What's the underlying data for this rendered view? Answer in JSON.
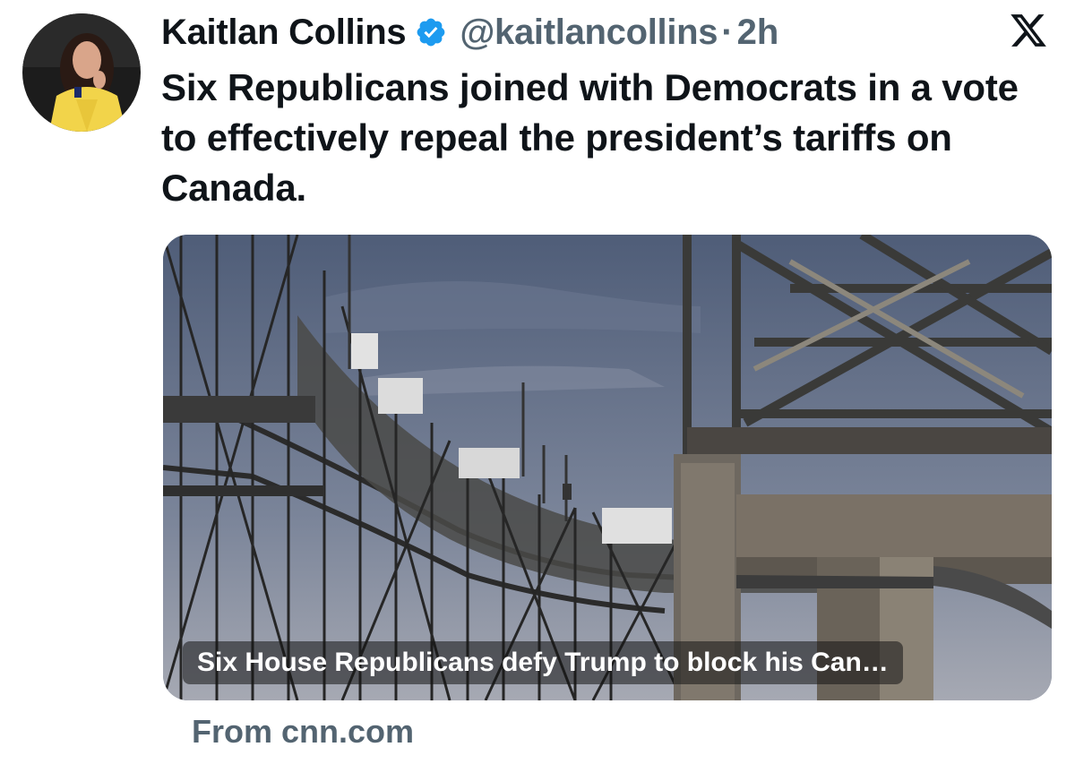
{
  "author": {
    "display_name": "Kaitlan Collins",
    "handle": "@kaitlancollins",
    "separator": "·",
    "time": "2h",
    "verified": true
  },
  "tweet": {
    "text": "Six Republicans joined with Democrats in a vote to effectively repeal the president’s tariffs on Canada."
  },
  "link_card": {
    "title": "Six House Republicans defy Trump to block his Can…",
    "source": "From cnn.com",
    "image_icon": "bridge-photo"
  },
  "icons": {
    "logo": "x-logo-icon",
    "verified": "verified-badge-icon"
  },
  "colors": {
    "text": "#0f1419",
    "secondary": "#536471",
    "verified": "#1d9bf0"
  }
}
